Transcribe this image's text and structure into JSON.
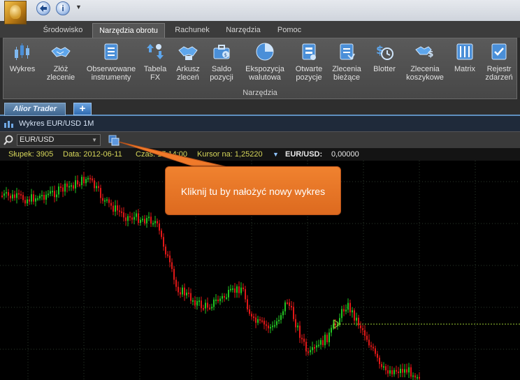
{
  "quick_access": {
    "logo_icon": "app-logo-icon",
    "back_icon": "back-arrow-icon",
    "info_label": "i",
    "dropdown_glyph": "▼"
  },
  "menu": {
    "tabs": [
      {
        "label": "Środowisko"
      },
      {
        "label": "Narzędzia obrotu",
        "active": true
      },
      {
        "label": "Rachunek"
      },
      {
        "label": "Narzędzia"
      },
      {
        "label": "Pomoc"
      }
    ]
  },
  "ribbon": {
    "group_label": "Narzędzia",
    "buttons": [
      {
        "label": "Wykres",
        "icon": "candlestick-chart-icon"
      },
      {
        "label": "Złóż\nzlecenie",
        "icon": "handshake-icon"
      },
      {
        "label": "Obserwowane\ninstrumenty",
        "icon": "watchlist-icon"
      },
      {
        "label": "Tabela\nFX",
        "icon": "fx-table-icon"
      },
      {
        "label": "Arkusz\nzleceń",
        "icon": "order-sheet-icon"
      },
      {
        "label": "Saldo\npozycji",
        "icon": "briefcase-icon"
      },
      {
        "label": "Ekspozycja\nwalutowa",
        "icon": "pie-chart-icon"
      },
      {
        "label": "Otwarte\npozycje",
        "icon": "open-positions-icon"
      },
      {
        "label": "Zlecenia\nbieżące",
        "icon": "pending-orders-icon"
      },
      {
        "label": "Blotter",
        "icon": "blotter-clock-icon"
      },
      {
        "label": "Zlecenia\nkoszykowe",
        "icon": "basket-orders-icon"
      },
      {
        "label": "Matrix",
        "icon": "matrix-icon"
      },
      {
        "label": "Rejestr\nzdarzeń",
        "icon": "event-log-icon"
      }
    ]
  },
  "doc_tabs": {
    "active": "Alior Trader",
    "add_label": "+"
  },
  "chart_window": {
    "title": "Wykres EUR/USD 1M"
  },
  "instrument": {
    "selected": "EUR/USD"
  },
  "status": {
    "bar": "Słupek: 3905",
    "date": "Data: 2012-06-11",
    "time": "Czas: 17:14:00",
    "cursor": "Kursor na: 1,25220",
    "pair": "EUR/USD:",
    "value": "0,00000"
  },
  "callout": {
    "text": "Kliknij tu by nałożyć nowy wykres"
  },
  "colors": {
    "up": "#22c422",
    "down": "#e01818",
    "accent": "#f07a2a",
    "grid": "#2c3a2c"
  }
}
